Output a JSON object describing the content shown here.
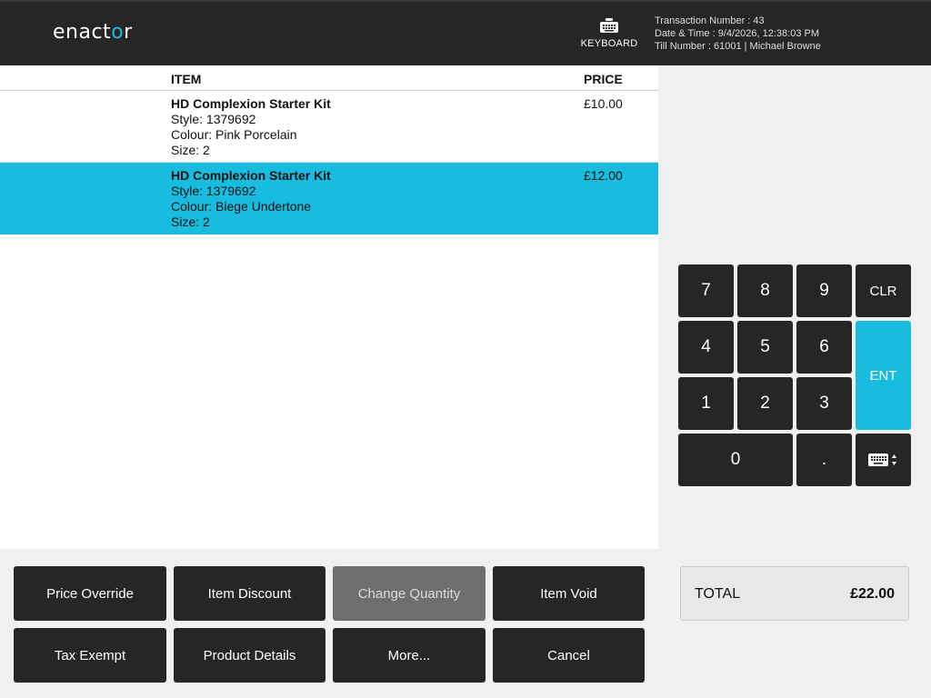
{
  "header": {
    "logo_pre": "enact",
    "logo_accent": "o",
    "logo_post": "r",
    "keyboard_label": "KEYBOARD",
    "transaction_line": "Transaction Number : 43",
    "datetime_line": "Date & Time : 9/4/2026, 12:38:03 PM",
    "till_line": "Till Number : 61001  |  Michael Browne"
  },
  "table": {
    "col_item": "ITEM",
    "col_price": "PRICE",
    "rows": [
      {
        "name": "HD Complexion Starter Kit",
        "style": "Style: 1379692",
        "colour": "Colour: Pink Porcelain",
        "size": "Size: 2",
        "price": "£10.00",
        "selected": false
      },
      {
        "name": "HD Complexion Starter Kit",
        "style": "Style: 1379692",
        "colour": "Colour: Biege Undertone",
        "size": "Size: 2",
        "price": "£12.00",
        "selected": true
      }
    ]
  },
  "numpad": {
    "k7": "7",
    "k8": "8",
    "k9": "9",
    "clr": "CLR",
    "k4": "4",
    "k5": "5",
    "k6": "6",
    "ent": "ENT",
    "k1": "1",
    "k2": "2",
    "k3": "3",
    "k0": "0",
    "dot": ".",
    "keyboard_toggle_icon": "keyboard-toggle-icon"
  },
  "actions": {
    "price_override": "Price Override",
    "item_discount": "Item Discount",
    "change_quantity": "Change Quantity",
    "item_void": "Item Void",
    "tax_exempt": "Tax Exempt",
    "product_details": "Product Details",
    "more": "More...",
    "cancel": "Cancel"
  },
  "total": {
    "label": "TOTAL",
    "value": "£22.00"
  },
  "colors": {
    "accent": "#18bcdf",
    "dark": "#262626",
    "disabled": "#6e6e6e"
  }
}
